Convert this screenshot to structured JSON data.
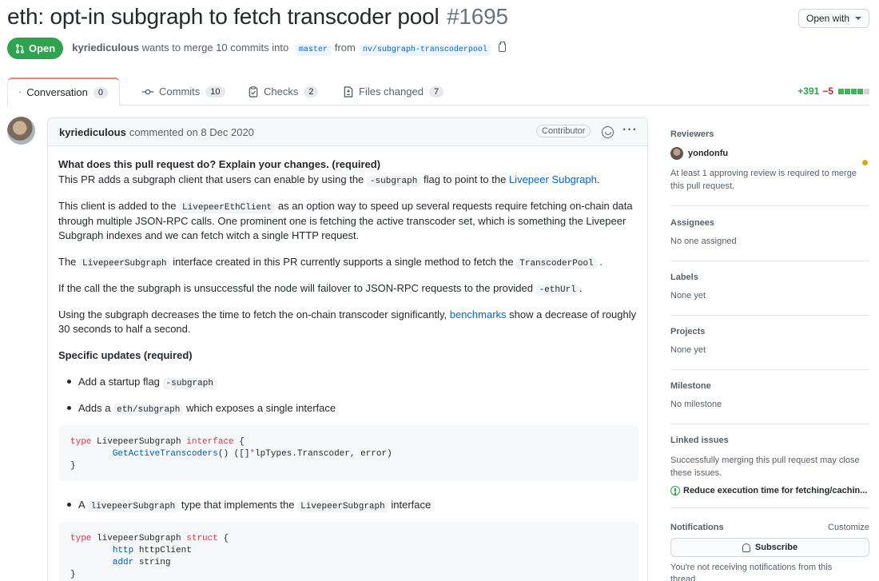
{
  "header": {
    "title": "eth: opt-in subgraph to fetch transcoder pool",
    "number": "#1695",
    "open_with": "Open with"
  },
  "state": {
    "badge": "Open",
    "author": "kyriediculous",
    "merge_text": "wants to merge 10 commits into",
    "base_branch": "master",
    "from_text": "from",
    "head_branch": "nv/subgraph-transcoderpool"
  },
  "tabs": [
    {
      "label": "Conversation",
      "count": "0",
      "icon": "conversation-icon"
    },
    {
      "label": "Commits",
      "count": "10",
      "icon": "commit-icon"
    },
    {
      "label": "Checks",
      "count": "2",
      "icon": "checks-icon"
    },
    {
      "label": "Files changed",
      "count": "7",
      "icon": "file-diff-icon"
    }
  ],
  "diffstat": {
    "additions": "+391",
    "deletions": "−5",
    "bar_colors": [
      "#2cbe4e",
      "#2cbe4e",
      "#2cbe4e",
      "#2cbe4e",
      "#d1d5da"
    ]
  },
  "comment": {
    "author": "kyriediculous",
    "meta": "commented on 8 Dec 2020",
    "role": "Contributor",
    "heading1": "What does this pull request do? Explain your changes. (required)",
    "p1_a": "This PR adds a subgraph client that users can enable by using the",
    "p1_code": "-subgraph",
    "p1_b": "flag to point to the",
    "p1_link": "Livepeer Subgraph",
    "p1_c": ".",
    "p2_a": "This client is added to the",
    "p2_code": "LivepeerEthClient",
    "p2_b": "as an option way to speed up several requests require fetching on-chain data",
    "p2_line2": "through multiple JSON-RPC calls. One prominent one is fetching the active transcoder set, which is something the Livepeer",
    "p2_line3": "Subgraph indexes and we can fetch witch a single HTTP request.",
    "p3_a": "The",
    "p3_code1": "LivepeerSubgraph",
    "p3_b": "interface created in this PR currently supports a single method to fetch the",
    "p3_code2": "TranscoderPool",
    "p3_c": ".",
    "p4_a": "If the call the the subgraph is unsuccessful the node will failover to JSON-RPC requests to the provided",
    "p4_code": "-ethUrl",
    "p4_b": ".",
    "p5_a": "Using the subgraph decreases the time to fetch the on-chain transcoder significantly,",
    "p5_link": "benchmarks",
    "p5_b": "show a decrease of roughly",
    "p5_line2": "30 seconds to half a second.",
    "heading2": "Specific updates (required)",
    "bullet1_a": "Add a startup flag",
    "bullet1_code": "-subgraph",
    "bullet2_a": "Adds a",
    "bullet2_code": "eth/subgraph",
    "bullet2_b": "which exposes a single interface",
    "code1_l1_kw": "type",
    "code1_l1_name": "LivepeerSubgraph",
    "code1_l1_kw2": "interface",
    "code1_l1_brace": "{",
    "code1_l2_fn": "GetActiveTranscoders",
    "code1_l2_rest": "() ([]",
    "code1_l2_star": "*",
    "code1_l2_rest2": "lpTypes.Transcoder, error)",
    "code1_l3": "}",
    "bullet3_a": "A",
    "bullet3_code1": "livepeerSubgraph",
    "bullet3_b": "type that implements the",
    "bullet3_code2": "LivepeerSubgraph",
    "bullet3_c": "interface",
    "code2_l1_kw": "type",
    "code2_l1_name": "livepeerSubgraph",
    "code2_l1_kw2": "struct",
    "code2_l1_brace": "{",
    "code2_l2_field": "http",
    "code2_l2_type": "httpClient",
    "code2_l3_field": "addr",
    "code2_l3_type": "string",
    "code2_l4": "}"
  },
  "sidebar": {
    "reviewers_title": "Reviewers",
    "reviewer_name": "yondonfu",
    "reviewers_note": "At least 1 approving review is required to merge this pull request.",
    "assignees_title": "Assignees",
    "assignees_value": "No one assigned",
    "labels_title": "Labels",
    "labels_value": "None yet",
    "projects_title": "Projects",
    "projects_value": "None yet",
    "milestone_title": "Milestone",
    "milestone_value": "No milestone",
    "linked_title": "Linked issues",
    "linked_note": "Successfully merging this pull request may close these issues.",
    "linked_issue": "Reduce execution time for fetching/cachin...",
    "notifications_title": "Notifications",
    "customize": "Customize",
    "subscribe": "Subscribe",
    "notif_note": "You're not receiving notifications from this thread."
  }
}
